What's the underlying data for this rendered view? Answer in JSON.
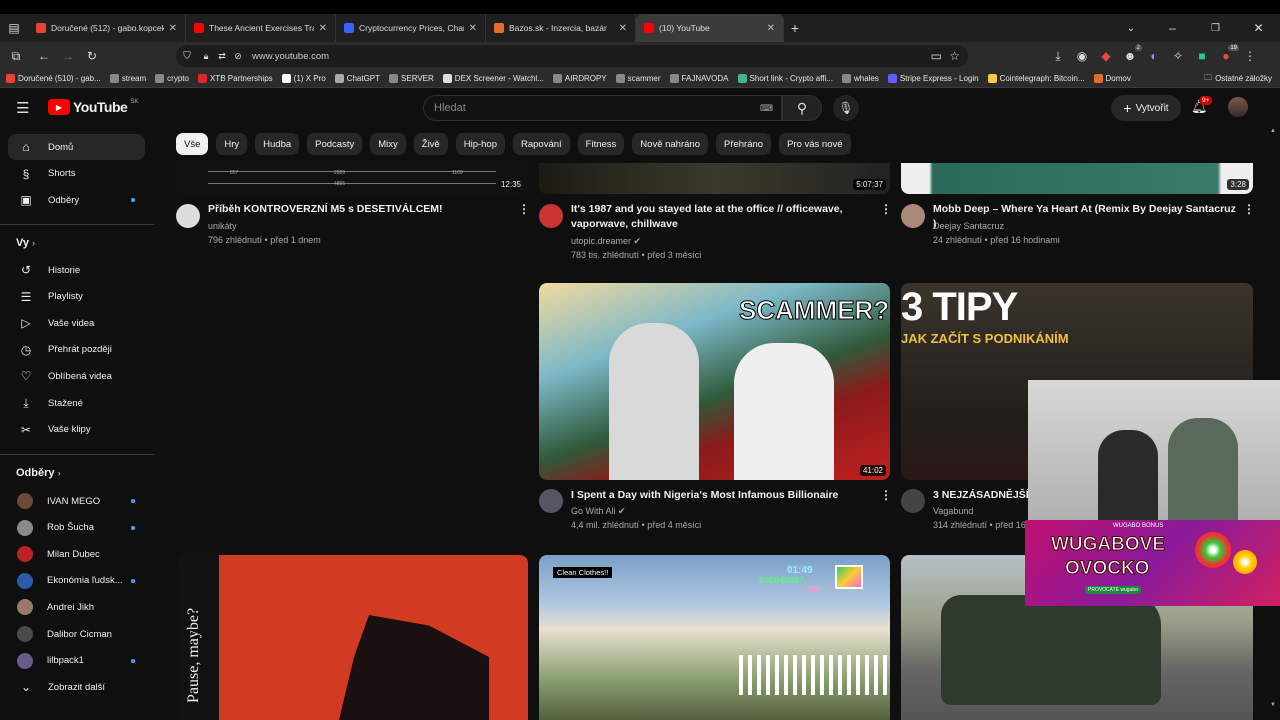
{
  "browser": {
    "tabs": [
      {
        "title": "Doručené (512) - gabo.kopcek@",
        "color": "#ea4335",
        "active": false
      },
      {
        "title": "These Ancient Exercises Transfo",
        "color": "#ff0000",
        "active": false
      },
      {
        "title": "Cryptocurrency Prices, Charts A",
        "color": "#3861fb",
        "active": false
      },
      {
        "title": "Bazos.sk - Inzercia, bazár",
        "color": "#e66a2c",
        "active": false
      },
      {
        "title": "(10) YouTube",
        "color": "#ff0000",
        "active": true
      }
    ],
    "url": "www.youtube.com",
    "bookmarks": [
      {
        "label": "Doručené (510) - gab...",
        "color": "#ea4335"
      },
      {
        "label": "stream",
        "color": "#888"
      },
      {
        "label": "crypto",
        "color": "#888"
      },
      {
        "label": "XTB Partnerships",
        "color": "#e0252b"
      },
      {
        "label": "(1) X Pro",
        "color": "#fff"
      },
      {
        "label": "ChatGPT",
        "color": "#aaa"
      },
      {
        "label": "SERVER",
        "color": "#888"
      },
      {
        "label": "DEX Screener - Watchl...",
        "color": "#ddd"
      },
      {
        "label": "AIRDROPY",
        "color": "#888"
      },
      {
        "label": "scammer",
        "color": "#888"
      },
      {
        "label": "FAJNAVODA",
        "color": "#888"
      },
      {
        "label": "Short link - Crypto affi...",
        "color": "#3fb68b"
      },
      {
        "label": "whales",
        "color": "#888"
      },
      {
        "label": "Stripe Express - Login",
        "color": "#635bff"
      },
      {
        "label": "Cointelegraph: Bitcoin...",
        "color": "#f7c948"
      },
      {
        "label": "Domov",
        "color": "#e66a2c"
      }
    ],
    "other_bookmarks": "Ostatné záložky",
    "badge_ext1": "2",
    "badge_ext2": "19"
  },
  "youtube": {
    "logo": "YouTube",
    "region": "SK",
    "search_placeholder": "Hledat",
    "create_label": "Vytvořit",
    "notif_badge": "9+",
    "chips": [
      "Vše",
      "Hry",
      "Hudba",
      "Podcasty",
      "Mixy",
      "Živě",
      "Hip-hop",
      "Rapování",
      "Fitness",
      "Nově nahráno",
      "Přehráno",
      "Pro vás nové"
    ],
    "sidebar": {
      "main": [
        {
          "label": "Domů",
          "icon": "home-icon",
          "glyph": "⌂"
        },
        {
          "label": "Shorts",
          "icon": "shorts-icon",
          "glyph": "§"
        },
        {
          "label": "Odběry",
          "icon": "subscriptions-icon",
          "glyph": "▣"
        }
      ],
      "you_title": "Vy",
      "you": [
        {
          "label": "Historie",
          "icon": "history-icon",
          "glyph": "↺"
        },
        {
          "label": "Playlisty",
          "icon": "playlists-icon",
          "glyph": "☰"
        },
        {
          "label": "Vaše videa",
          "icon": "your-videos-icon",
          "glyph": "▷"
        },
        {
          "label": "Přehrát později",
          "icon": "watch-later-icon",
          "glyph": "◷"
        },
        {
          "label": "Oblíbená videa",
          "icon": "liked-icon",
          "glyph": "♡"
        },
        {
          "label": "Stažené",
          "icon": "downloads-icon",
          "glyph": "⤓"
        },
        {
          "label": "Vaše klipy",
          "icon": "clips-icon",
          "glyph": "✂"
        }
      ],
      "subs_title": "Odběry",
      "subs": [
        {
          "label": "IVAN MEGO",
          "color": "#6b4a3a",
          "dot": true
        },
        {
          "label": "Rob Šucha",
          "color": "#8a8a8a",
          "dot": true
        },
        {
          "label": "Milan Dubec",
          "color": "#b22",
          "dot": false
        },
        {
          "label": "Ekonómia ľudsk...",
          "color": "#2a5caa",
          "dot": true
        },
        {
          "label": "Andrei Jikh",
          "color": "#9a7a6a",
          "dot": false
        },
        {
          "label": "Dalibor Cicman",
          "color": "#4a4a4a",
          "dot": false
        },
        {
          "label": "lilbpack1",
          "color": "#6a5a8a",
          "dot": true
        }
      ],
      "show_more": "Zobrazit další"
    },
    "videos": [
      {
        "title": "Příběh KONTROVERZNÍ M5 s DESETIVÁLCEM!",
        "channel": "unikáty",
        "meta": "796 zhlédnutí • před 1 dnem",
        "duration": "12:35",
        "avatar": "#ddd",
        "verified": false
      },
      {
        "title": "It's 1987 and you stayed late at the office // officewave, vaporwave, chillwave",
        "channel": "utopic.dreamer",
        "meta": "783 tis. zhlédnutí • před 3 měsíci",
        "duration": "5:07:37",
        "avatar": "#c33",
        "verified": true
      },
      {
        "title": "Mobb Deep – Where Ya Heart At (Remix By Deejay Santacruz )",
        "channel": "Deejay Santacruz",
        "meta": "24 zhlédnutí • před 16 hodinami",
        "duration": "3:28",
        "avatar": "#a87",
        "verified": false
      },
      {
        "title": "I Spent a Day with Nigeria's Most Infamous Billionaire",
        "channel": "Go With Ali",
        "meta": "4,4 mil. zhlédnutí • před 4 měsíci",
        "duration": "41:02",
        "avatar": "#556",
        "verified": true
      },
      {
        "title": "3 NEJZÁSADNĚJŠÍ T",
        "channel": "Vagabund",
        "meta": "314 zhlédnutí • před 16",
        "duration": "",
        "avatar": "#444",
        "verified": false
      }
    ],
    "thumb_texts": {
      "scammer": "SCAMMER?",
      "tipy": "3 TIPY",
      "tipy_sub": "JAK ZAČÍT S PODNIKÁNÍM",
      "pause": "Pause, maybe?",
      "gta_caption": "Clean Clothes!!",
      "gta_time": "01:49",
      "gta_money": "$00048897",
      "gta_100": "100",
      "waveform_vals": [
        "857",
        "2889",
        "1109",
        "4855"
      ]
    },
    "overlay": {
      "small": "WUGABO BONUS",
      "line1": "WUGABOVE",
      "line2": "OVOCKO",
      "sub": "PROVOCATE wugabo"
    }
  }
}
